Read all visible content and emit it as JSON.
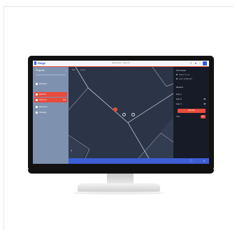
{
  "app": {
    "brand": "Ridge",
    "title": "Field survey · sector 07"
  },
  "sidebar": {
    "header": "Projects",
    "items": [
      {
        "label": "Boundary",
        "value": ""
      },
      {
        "label": "North lot",
        "value": "",
        "active": true
      },
      {
        "label": "Parcel 12",
        "value": "8.4",
        "active": true
      },
      {
        "label": "Easement",
        "value": ""
      },
      {
        "label": "Drainage",
        "value": ""
      }
    ]
  },
  "map": {
    "tabs": [
      "Map",
      "Layers"
    ]
  },
  "right_panel": {
    "title": "Plot Detail",
    "rows": [
      "Owner: K. Lee",
      "Area: 12,400 sq ft"
    ],
    "section": "Measure",
    "items": [
      {
        "label": "Edge A",
        "value": ""
      },
      {
        "label": "Edge B",
        "value": "22"
      },
      {
        "label": "Edge C",
        "value": "18"
      }
    ],
    "button": "Add point",
    "footer_item": {
      "label": "Total",
      "tag": "0.8"
    }
  },
  "colors": {
    "accent": "#e84b3c",
    "primary": "#3d5ed4",
    "sidebar": "#7e92b0",
    "map": "#2b3547"
  }
}
